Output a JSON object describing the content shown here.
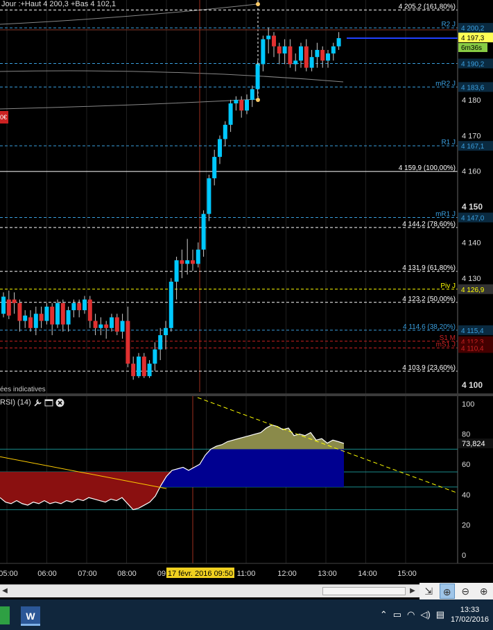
{
  "header": {
    "info_text": "Jour :+Haut 4 200,3 +Bas 4 102,1"
  },
  "main_chart": {
    "footer_note": "ées indicatives",
    "left_badge": "0€",
    "candles": [
      [
        4120.0,
        4124.8,
        4126.0,
        4119.0
      ],
      [
        4124.0,
        4119.5,
        4126.5,
        4118.5
      ],
      [
        4124.0,
        4123.0,
        4126.0,
        4120.0
      ],
      [
        4123.0,
        4118.0,
        4124.0,
        4115.0
      ],
      [
        4118.0,
        4119.5,
        4121.0,
        4116.0
      ],
      [
        4119.0,
        4116.0,
        4121.0,
        4115.0
      ],
      [
        4116.0,
        4120.0,
        4122.0,
        4114.0
      ],
      [
        4120.0,
        4118.0,
        4122.0,
        4116.0
      ],
      [
        4118.0,
        4122.0,
        4123.0,
        4117.0
      ],
      [
        4122.0,
        4117.0,
        4123.0,
        4114.0
      ],
      [
        4117.0,
        4123.0,
        4124.0,
        4116.0
      ],
      [
        4123.0,
        4117.0,
        4124.0,
        4115.0
      ],
      [
        4117.0,
        4121.0,
        4122.0,
        4115.0
      ],
      [
        4121.0,
        4123.0,
        4124.0,
        4119.0
      ],
      [
        4123.0,
        4121.0,
        4124.0,
        4119.0
      ],
      [
        4121.0,
        4124.0,
        4125.0,
        4120.0
      ],
      [
        4124.0,
        4118.0,
        4125.0,
        4116.0
      ],
      [
        4118.0,
        4116.0,
        4120.0,
        4114.0
      ],
      [
        4116.0,
        4117.0,
        4119.0,
        4114.0
      ],
      [
        4117.0,
        4116.0,
        4118.0,
        4113.0
      ],
      [
        4116.0,
        4119.0,
        4120.0,
        4115.0
      ],
      [
        4119.0,
        4115.0,
        4120.0,
        4114.0
      ],
      [
        4115.0,
        4118.0,
        4120.0,
        4113.0
      ],
      [
        4118.0,
        4106.0,
        4122.0,
        4105.0
      ],
      [
        4106.0,
        4102.5,
        4108.0,
        4101.5
      ],
      [
        4102.5,
        4108.0,
        4109.0,
        4102.0
      ],
      [
        4108.0,
        4102.5,
        4109.0,
        4102.0
      ],
      [
        4102.5,
        4106.0,
        4107.0,
        4102.0
      ],
      [
        4106.0,
        4110.0,
        4112.0,
        4104.0
      ],
      [
        4110.0,
        4114.0,
        4116.0,
        4107.0
      ],
      [
        4114.0,
        4116.0,
        4118.0,
        4110.0
      ],
      [
        4116.0,
        4129.0,
        4130.0,
        4115.0
      ],
      [
        4129.0,
        4135.0,
        4136.0,
        4124.0
      ],
      [
        4135.0,
        4134.0,
        4138.0,
        4130.0
      ],
      [
        4134.0,
        4135.0,
        4141.0,
        4131.0
      ],
      [
        4135.0,
        4134.0,
        4138.0,
        4132.0
      ],
      [
        4134.0,
        4138.0,
        4140.0,
        4133.0
      ],
      [
        4138.0,
        4148.0,
        4149.0,
        4136.0
      ],
      [
        4148.0,
        4158.0,
        4159.0,
        4146.0
      ],
      [
        4158.0,
        4164.0,
        4166.0,
        4156.0
      ],
      [
        4164.0,
        4169.0,
        4170.0,
        4162.0
      ],
      [
        4169.0,
        4173.0,
        4174.0,
        4167.0
      ],
      [
        4173.0,
        4179.0,
        4180.0,
        4171.0
      ],
      [
        4179.0,
        4180.0,
        4181.0,
        4177.0
      ],
      [
        4180.0,
        4177.0,
        4181.0,
        4175.0
      ],
      [
        4177.0,
        4180.0,
        4181.5,
        4176.0
      ],
      [
        4180.0,
        4183.0,
        4184.0,
        4178.0
      ],
      [
        4183.0,
        4190.0,
        4191.0,
        4181.0
      ],
      [
        4190.0,
        4197.0,
        4198.0,
        4188.0
      ],
      [
        4197.0,
        4198.0,
        4200.3,
        4193.0
      ],
      [
        4198.0,
        4195.0,
        4199.0,
        4192.0
      ],
      [
        4195.0,
        4193.0,
        4196.0,
        4190.0
      ],
      [
        4193.0,
        4195.0,
        4197.0,
        4190.0
      ],
      [
        4195.0,
        4190.0,
        4197.0,
        4189.0
      ],
      [
        4190.0,
        4191.0,
        4193.0,
        4188.0
      ],
      [
        4191.0,
        4195.0,
        4196.0,
        4189.0
      ],
      [
        4195.0,
        4189.0,
        4197.0,
        4188.0
      ],
      [
        4189.0,
        4192.0,
        4194.0,
        4188.0
      ],
      [
        4192.0,
        4194.0,
        4196.0,
        4189.0
      ],
      [
        4194.0,
        4191.0,
        4195.0,
        4189.0
      ],
      [
        4191.0,
        4193.0,
        4194.0,
        4189.0
      ],
      [
        4193.0,
        4195.0,
        4196.0,
        4191.0
      ],
      [
        4195.0,
        4197.3,
        4199.0,
        4194.0
      ]
    ],
    "horizontal_lines": [
      {
        "price": 4205.2,
        "label": "4 205,2 (161,80%)",
        "color": "#ffffff",
        "style": "dashed",
        "tag": ""
      },
      {
        "price": 4200.2,
        "label": "R2 J",
        "color": "#3aa0e0",
        "style": "dashed",
        "tag": "4 200,2"
      },
      {
        "price": 4190.2,
        "label": "",
        "color": "#3aa0e0",
        "style": "dashed",
        "tag": "4 190,2"
      },
      {
        "price": 4183.6,
        "label": "mR2 J",
        "color": "#3aa0e0",
        "style": "dashed",
        "tag": "4 183,6"
      },
      {
        "price": 4167.1,
        "label": "R1 J",
        "color": "#3aa0e0",
        "style": "dashed",
        "tag": "4 167,1"
      },
      {
        "price": 4159.9,
        "label": "4 159,9 (100,00%)",
        "color": "#ffffff",
        "style": "solid",
        "tag": ""
      },
      {
        "price": 4147.0,
        "label": "mR1 J",
        "color": "#3aa0e0",
        "style": "dashed",
        "tag": "4 147,0"
      },
      {
        "price": 4144.2,
        "label": "4 144,2 (78,60%)",
        "color": "#ffffff",
        "style": "dashed",
        "tag": ""
      },
      {
        "price": 4131.9,
        "label": "4 131,9 (61,80%)",
        "color": "#ffffff",
        "style": "dashed",
        "tag": ""
      },
      {
        "price": 4126.9,
        "label": "Piv J",
        "color": "#ffff00",
        "style": "dashed",
        "tag": "4 126,9"
      },
      {
        "price": 4123.2,
        "label": "4 123,2 (50,00%)",
        "color": "#ffffff",
        "style": "dashed",
        "tag": ""
      },
      {
        "price": 4115.4,
        "label": "4 114,6 (38,20%)",
        "color": "#3aa0e0",
        "style": "dashed",
        "tag": "4 115,4"
      },
      {
        "price": 4112.3,
        "label": "S1 M",
        "color": "#cc2222",
        "style": "dashed",
        "tag": "4 112,3"
      },
      {
        "price": 4110.4,
        "label": "mS1 J",
        "color": "#cc2222",
        "style": "dashed",
        "tag": "4 110,4"
      },
      {
        "price": 4103.9,
        "label": "4 103,9 (23,60%)",
        "color": "#ffffff",
        "style": "dashed",
        "tag": ""
      }
    ],
    "current_price": {
      "label": "4 197,3",
      "countdown": "6m36s"
    },
    "price_axis": [
      "4 180",
      "4 170",
      "4 160",
      "4 150",
      "4 140",
      "4 130",
      "4 100"
    ]
  },
  "rsi": {
    "label": "RSI) (14)",
    "current_value": "73,824",
    "axis": [
      "100",
      "80",
      "60",
      "40",
      "20",
      "0"
    ],
    "values": [
      38,
      35,
      34,
      36,
      34,
      33,
      35,
      34,
      36,
      34,
      35,
      34,
      36,
      35,
      37,
      36,
      38,
      37,
      36,
      35,
      37,
      36,
      38,
      34,
      30,
      31,
      33,
      35,
      39,
      46,
      52,
      56,
      57,
      58,
      56,
      58,
      60,
      66,
      70,
      72,
      73,
      75,
      76,
      77,
      78,
      79,
      80,
      81,
      84,
      86,
      85,
      83,
      84,
      79,
      80,
      79,
      81,
      76,
      77,
      74,
      76,
      75,
      73.8
    ]
  },
  "time_axis": [
    "05:00",
    "06:00",
    "07:00",
    "08:00",
    "09",
    "11:00",
    "12:00",
    "13:00",
    "14:00",
    "15:00"
  ],
  "cursor_label": "17 févr. 2016 09:50",
  "taskbar": {
    "time": "13:33",
    "date": "17/02/2016",
    "word_icon": "W"
  }
}
